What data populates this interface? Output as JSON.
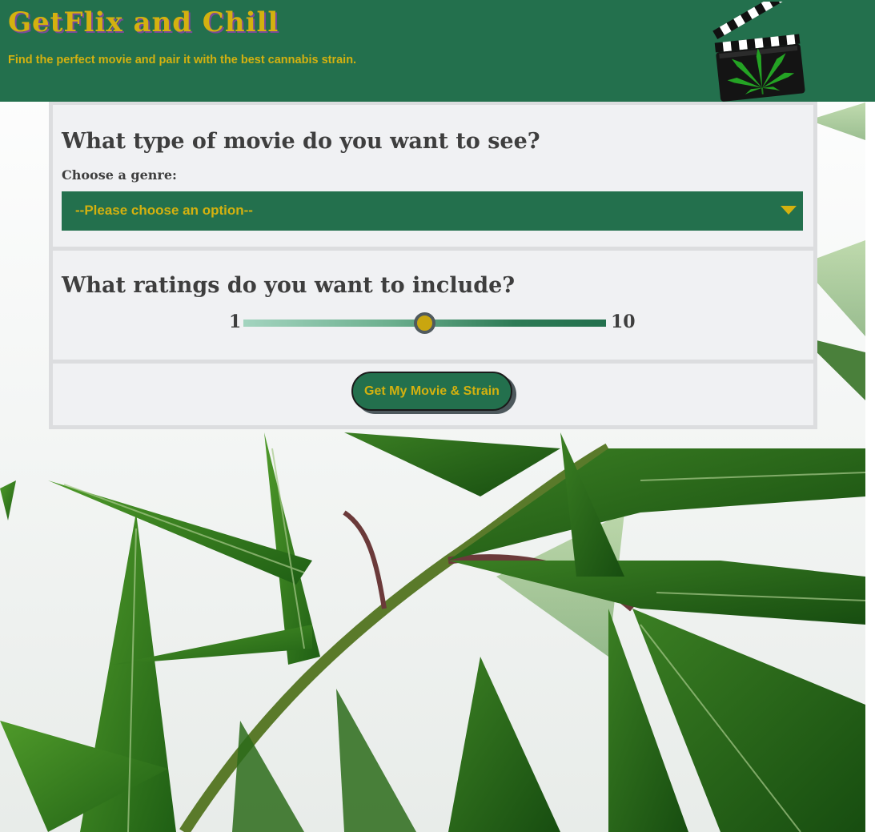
{
  "header": {
    "title": "GetFlix and Chill",
    "tagline": "Find the perfect movie and pair it with the best cannabis strain.",
    "logo_icon": "clapperboard-cannabis-leaf-icon"
  },
  "genre_section": {
    "question": "What type of movie do you want to see?",
    "label": "Choose a genre:",
    "selected_value": "--Please choose an option--",
    "arrow_icon": "triangle-down-icon"
  },
  "rating_section": {
    "question": "What ratings do you want to include?",
    "min_label": "1",
    "max_label": "10",
    "value": 5.5
  },
  "submit": {
    "label": "Get My Movie & Strain"
  },
  "background": {
    "image": "cannabis-plant-photo"
  },
  "colors": {
    "brand_green": "#23704d",
    "accent_gold": "#d4b10f",
    "heading_text": "#3e3e3e",
    "panel_bg": "#f0f1f3"
  }
}
